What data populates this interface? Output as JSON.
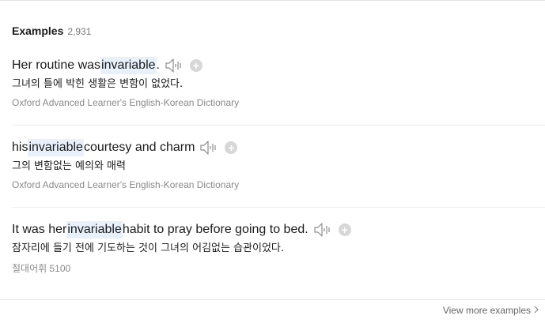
{
  "section": {
    "title": "Examples",
    "count": "2,931"
  },
  "examples": [
    {
      "parts": [
        "Her routine was ",
        "invariable",
        "."
      ],
      "translation": "그녀의 틀에 박힌 생활은 변함이 없었다.",
      "source": "Oxford Advanced Learner's English-Korean Dictionary"
    },
    {
      "parts": [
        "his ",
        "invariable",
        " courtesy and charm"
      ],
      "translation": "그의 변함없는 예의와 매력",
      "source": "Oxford Advanced Learner's English-Korean Dictionary"
    },
    {
      "parts": [
        "It was her ",
        "invariable",
        " habit to pray before going to bed."
      ],
      "translation": "잠자리에 들기 전에 기도하는 것이 그녀의 어김없는 습관이었다.",
      "source": "절대어휘 5100"
    }
  ],
  "footer": {
    "view_more_label": "View more examples"
  },
  "colors": {
    "highlight": "#e8f1fb",
    "plus_button": "#d7d7d7",
    "source_text": "#8a8a8a"
  },
  "icons": {
    "speaker": "speaker-icon",
    "add": "add-icon",
    "chevron": "chevron-right-icon"
  }
}
